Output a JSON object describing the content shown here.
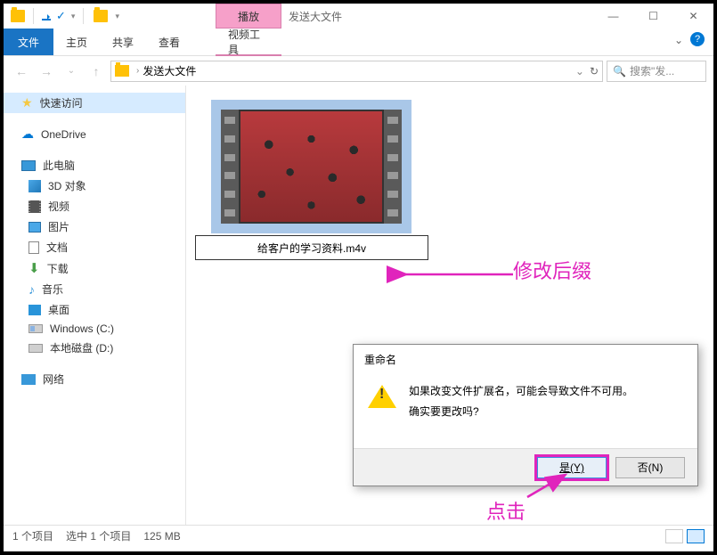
{
  "window": {
    "title": "发送大文件",
    "play_tab": "播放",
    "ribbon": {
      "file": "文件",
      "home": "主页",
      "share": "共享",
      "view": "查看",
      "video_tools": "视频工具"
    }
  },
  "addr": {
    "path": "发送大文件",
    "caret": "›"
  },
  "search": {
    "placeholder": "搜索\"发..."
  },
  "sidebar": {
    "quick": "快速访问",
    "onedrive": "OneDrive",
    "pc": "此电脑",
    "obj3d": "3D 对象",
    "video": "视频",
    "pictures": "图片",
    "docs": "文档",
    "downloads": "下载",
    "music": "音乐",
    "desktop": "桌面",
    "disk_c": "Windows (C:)",
    "disk_d": "本地磁盘 (D:)",
    "network": "网络"
  },
  "file": {
    "name": "给客户的学习资料.m4v"
  },
  "dialog": {
    "title": "重命名",
    "line1": "如果改变文件扩展名，可能会导致文件不可用。",
    "line2": "确实要更改吗?",
    "yes": "是(Y)",
    "no": "否(N)"
  },
  "status": {
    "count": "1 个项目",
    "selected": "选中 1 个项目",
    "size": "125 MB"
  },
  "callout": {
    "rename": "修改后缀",
    "click": "点击"
  }
}
